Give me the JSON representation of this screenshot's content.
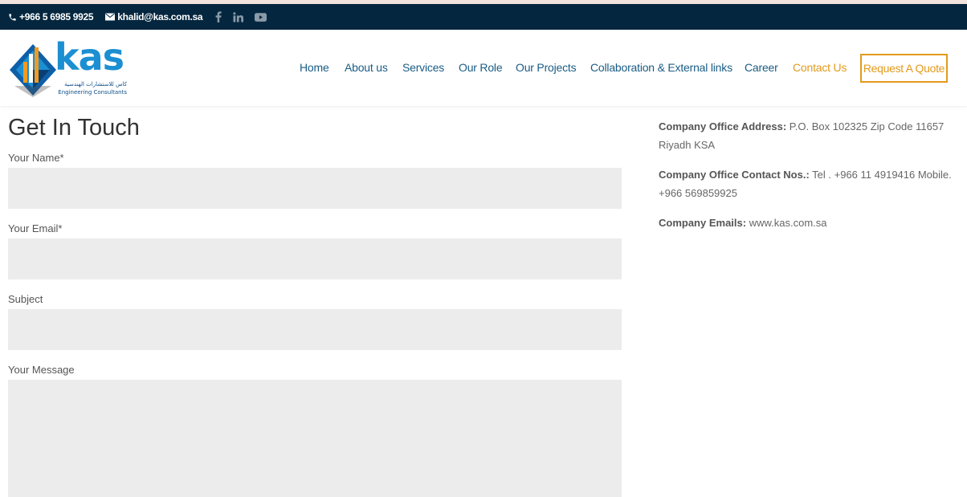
{
  "topbar": {
    "phone": "+966 5 6985 9925",
    "email": "khalid@kas.com.sa",
    "social_icons": [
      "facebook-icon",
      "linkedin-icon",
      "youtube-icon"
    ]
  },
  "logo": {
    "word": "kas",
    "arabic": "كاس للاستشارات الهندسية",
    "english": "Engineering Consultants"
  },
  "nav": {
    "items": [
      {
        "label": "Home"
      },
      {
        "label": "About us"
      },
      {
        "label": "Services"
      },
      {
        "label": "Our Role"
      },
      {
        "label": "Our Projects"
      },
      {
        "label": "Collaboration & External links"
      },
      {
        "label": "Career"
      },
      {
        "label": "Contact Us",
        "active": true
      }
    ],
    "quote_button": "Request A Quote"
  },
  "form": {
    "heading": "Get In Touch",
    "fields": [
      {
        "label": "Your Name*",
        "value": ""
      },
      {
        "label": "Your Email*",
        "value": ""
      },
      {
        "label": "Subject",
        "value": ""
      },
      {
        "label": "Your Message",
        "value": ""
      }
    ]
  },
  "info": {
    "address_key": "Company Office Address:",
    "address_val": " P.O. Box 102325 Zip Code 11657 Riyadh KSA",
    "contact_key": "Company Office Contact Nos.:",
    "contact_val": " Tel . +966 11 4919416 Mobile. +966 569859925",
    "emails_key": "Company Emails:",
    "emails_val": " www.kas.com.sa"
  },
  "colors": {
    "topbar_bg": "#04273f",
    "nav_link": "#1a5c84",
    "accent": "#e39a1c",
    "field_bg": "#ececec"
  }
}
